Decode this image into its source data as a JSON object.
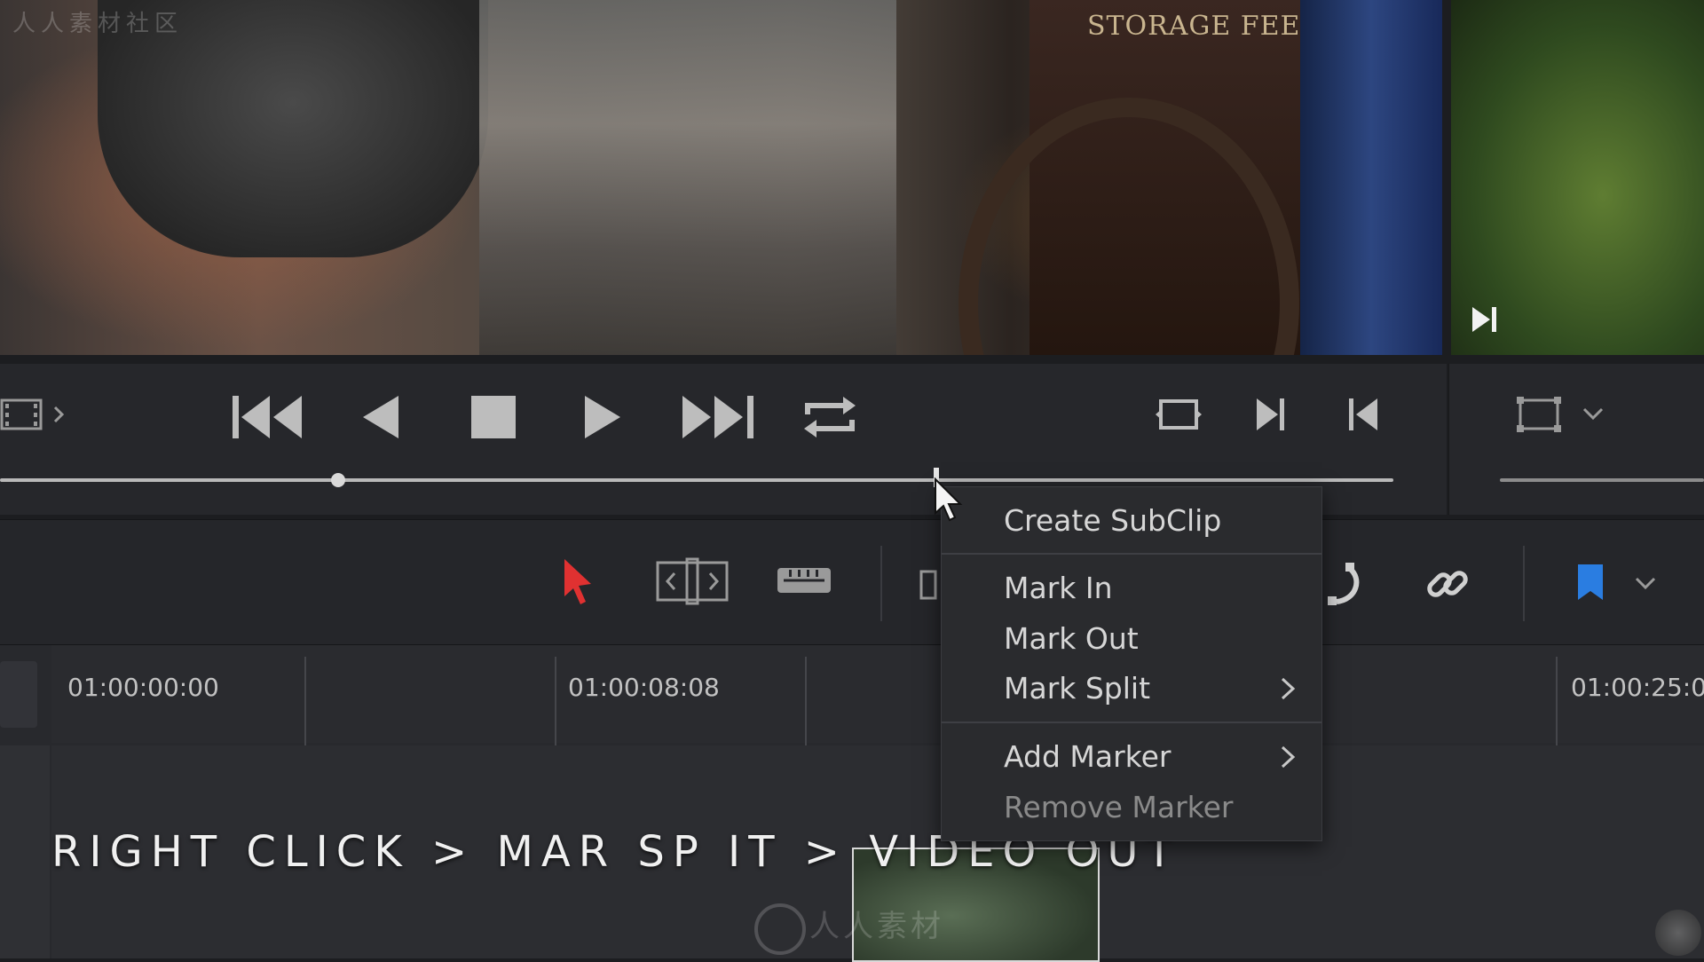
{
  "watermark_top_left": "人人素材社区",
  "watermark_center": "人人素材",
  "viewer": {
    "sign_title": "STORAGE FEE"
  },
  "transport": {
    "buttons": [
      "clip-view-icon",
      "jump-to-start-icon",
      "play-reverse-icon",
      "stop-icon",
      "play-icon",
      "jump-to-end-icon",
      "loop-icon",
      "match-frame-icon",
      "next-edit-icon",
      "previous-edit-icon",
      "viewer-mode-icon"
    ]
  },
  "toolbar": {
    "tools": [
      "selection-tool-icon",
      "trim-tool-icon",
      "blade-tool-icon",
      "snapping-icon",
      "link-icon",
      "flag-icon"
    ],
    "accent_selection": "#e03131",
    "accent_flag": "#2a7de1"
  },
  "timeline": {
    "timecodes": [
      "01:00:00:00",
      "01:00:08:08",
      "01:00:25:0"
    ]
  },
  "context_menu": {
    "items": [
      {
        "label": "Create SubClip",
        "enabled": true
      },
      {
        "label": "Mark In",
        "enabled": true
      },
      {
        "label": "Mark Out",
        "enabled": true
      },
      {
        "label": "Mark Split",
        "enabled": true,
        "submenu": true
      },
      {
        "label": "Add Marker",
        "enabled": true,
        "submenu": true
      },
      {
        "label": "Remove Marker",
        "enabled": false
      }
    ]
  },
  "subtitle": "RIGHT CLICK > MAR  SP IT > VIDEO OUT"
}
